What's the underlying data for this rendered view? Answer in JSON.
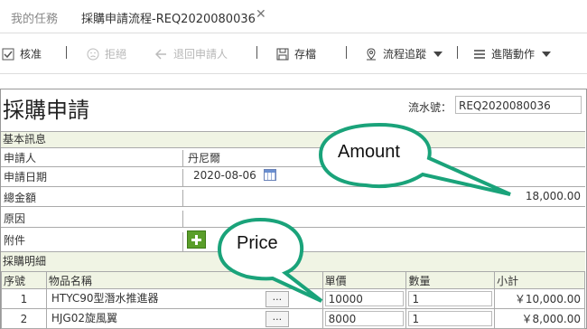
{
  "tabs": {
    "inactive": "我的任務",
    "active": "採購申請流程-REQ2020080036",
    "close": "✕"
  },
  "toolbar": {
    "approve": "核准",
    "reject": "拒絕",
    "return": "退回申請人",
    "save": "存檔",
    "track": "流程追蹤",
    "advanced": "進階動作"
  },
  "form": {
    "title": "採購申請",
    "serial_label": "流水號：",
    "serial_value": "REQ2020080036",
    "section_basic": "基本訊息",
    "applicant_label": "申請人",
    "applicant_value": "丹尼爾",
    "date_label": "申請日期",
    "date_value": "2020-08-06",
    "total_label": "總金額",
    "total_value": "18,000.00",
    "reason_label": "原因",
    "attach_label": "附件",
    "section_detail": "採購明細"
  },
  "table": {
    "headers": [
      "序號",
      "物品名稱",
      "單價",
      "數量",
      "小計"
    ],
    "rows": [
      {
        "no": "1",
        "name": "HTYC90型潛水推進器",
        "price": "10000",
        "qty": "1",
        "subtotal": "￥10,000.00"
      },
      {
        "no": "2",
        "name": "HJG02旋風翼",
        "price": "8000",
        "qty": "1",
        "subtotal": "￥8,000.00"
      }
    ],
    "browse": "..."
  },
  "callouts": {
    "amount": "Amount",
    "price": "Price"
  },
  "colors": {
    "section_bg": "#f0f4e4",
    "callout_border": "#1aa37a",
    "add_green": "#5a9e2a"
  }
}
